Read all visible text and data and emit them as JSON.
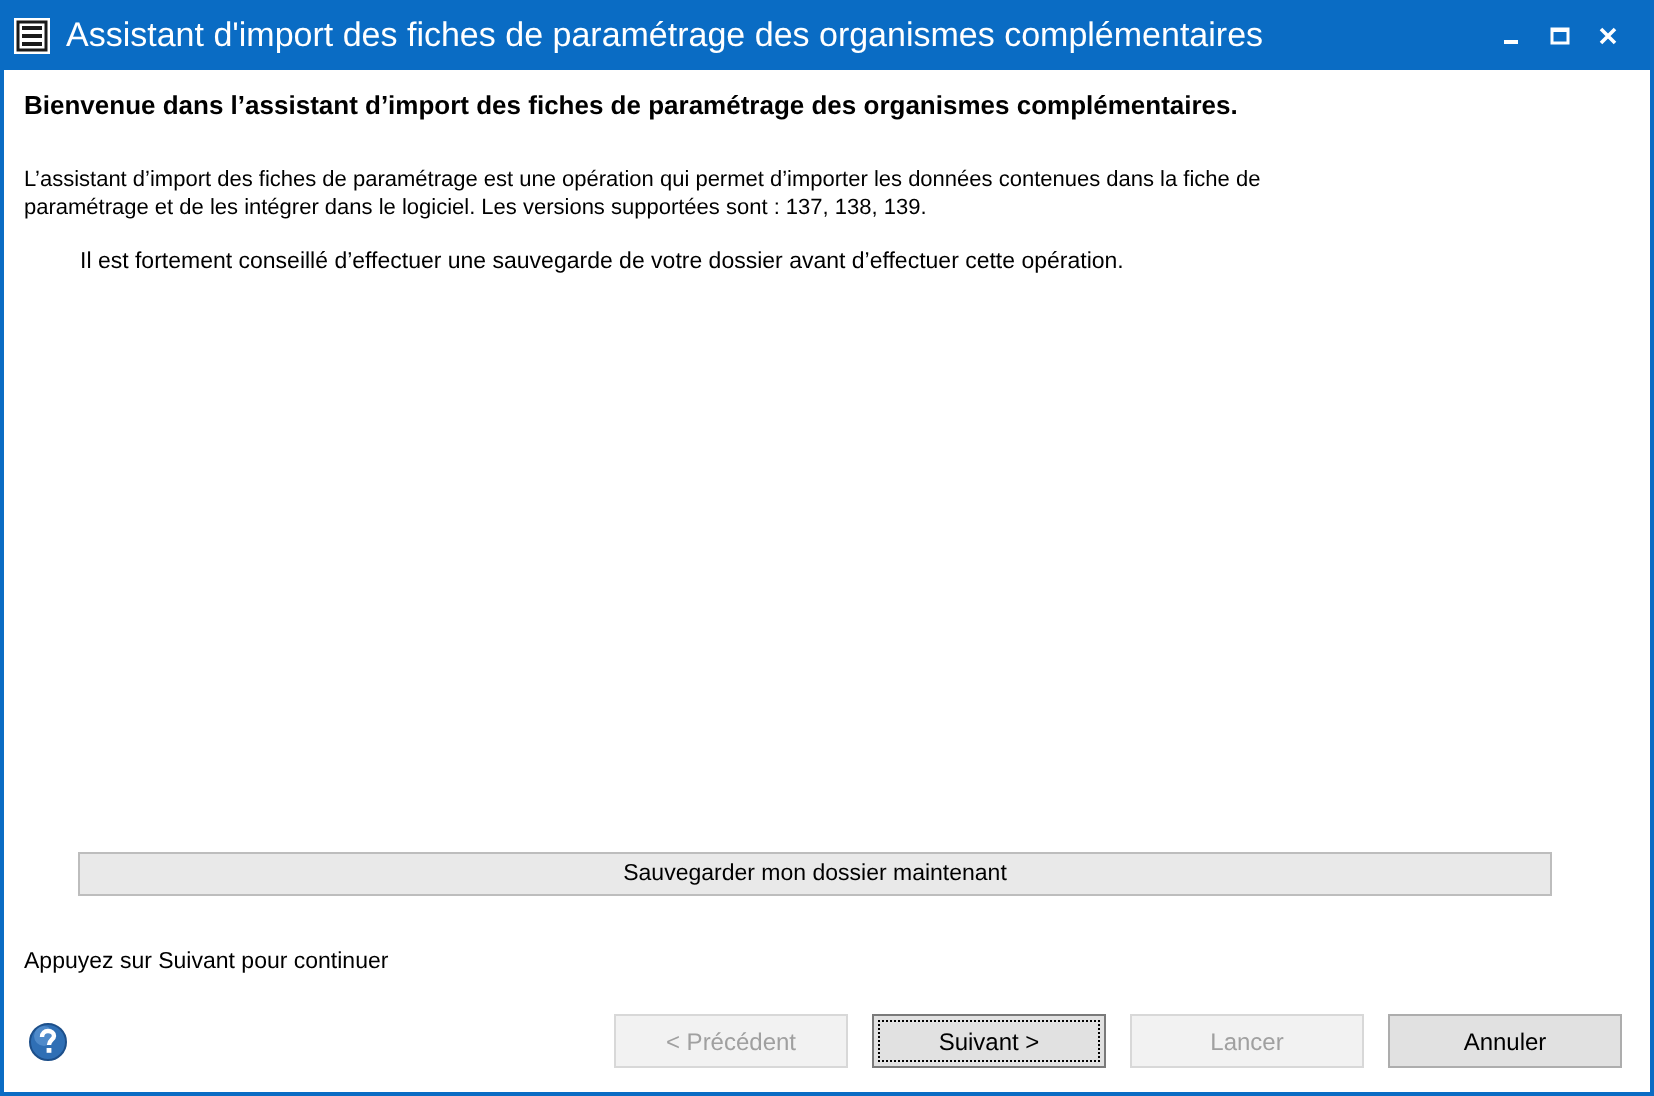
{
  "window": {
    "title": "Assistant d'import des fiches de paramétrage des organismes complémentaires"
  },
  "heading": "Bienvenue dans l’assistant d’import des fiches de paramétrage des organismes complémentaires.",
  "description": "L’assistant d’import des fiches de paramétrage est une opération qui permet d’importer les données contenues dans la fiche de paramétrage et de les intégrer dans le logiciel. Les versions supportées sont : 137, 138, 139.",
  "advice": "Il est fortement conseillé d’effectuer une sauvegarde de votre dossier avant d’effectuer cette opération.",
  "save_button": "Sauvegarder mon dossier maintenant",
  "instruction": "Appuyez sur Suivant pour continuer",
  "buttons": [
    {
      "label": "< Précédent",
      "disabled": true,
      "focused": false
    },
    {
      "label": "Suivant >",
      "disabled": false,
      "focused": true
    },
    {
      "label": "Lancer",
      "disabled": true,
      "focused": false
    },
    {
      "label": "Annuler",
      "disabled": false,
      "focused": false
    }
  ]
}
